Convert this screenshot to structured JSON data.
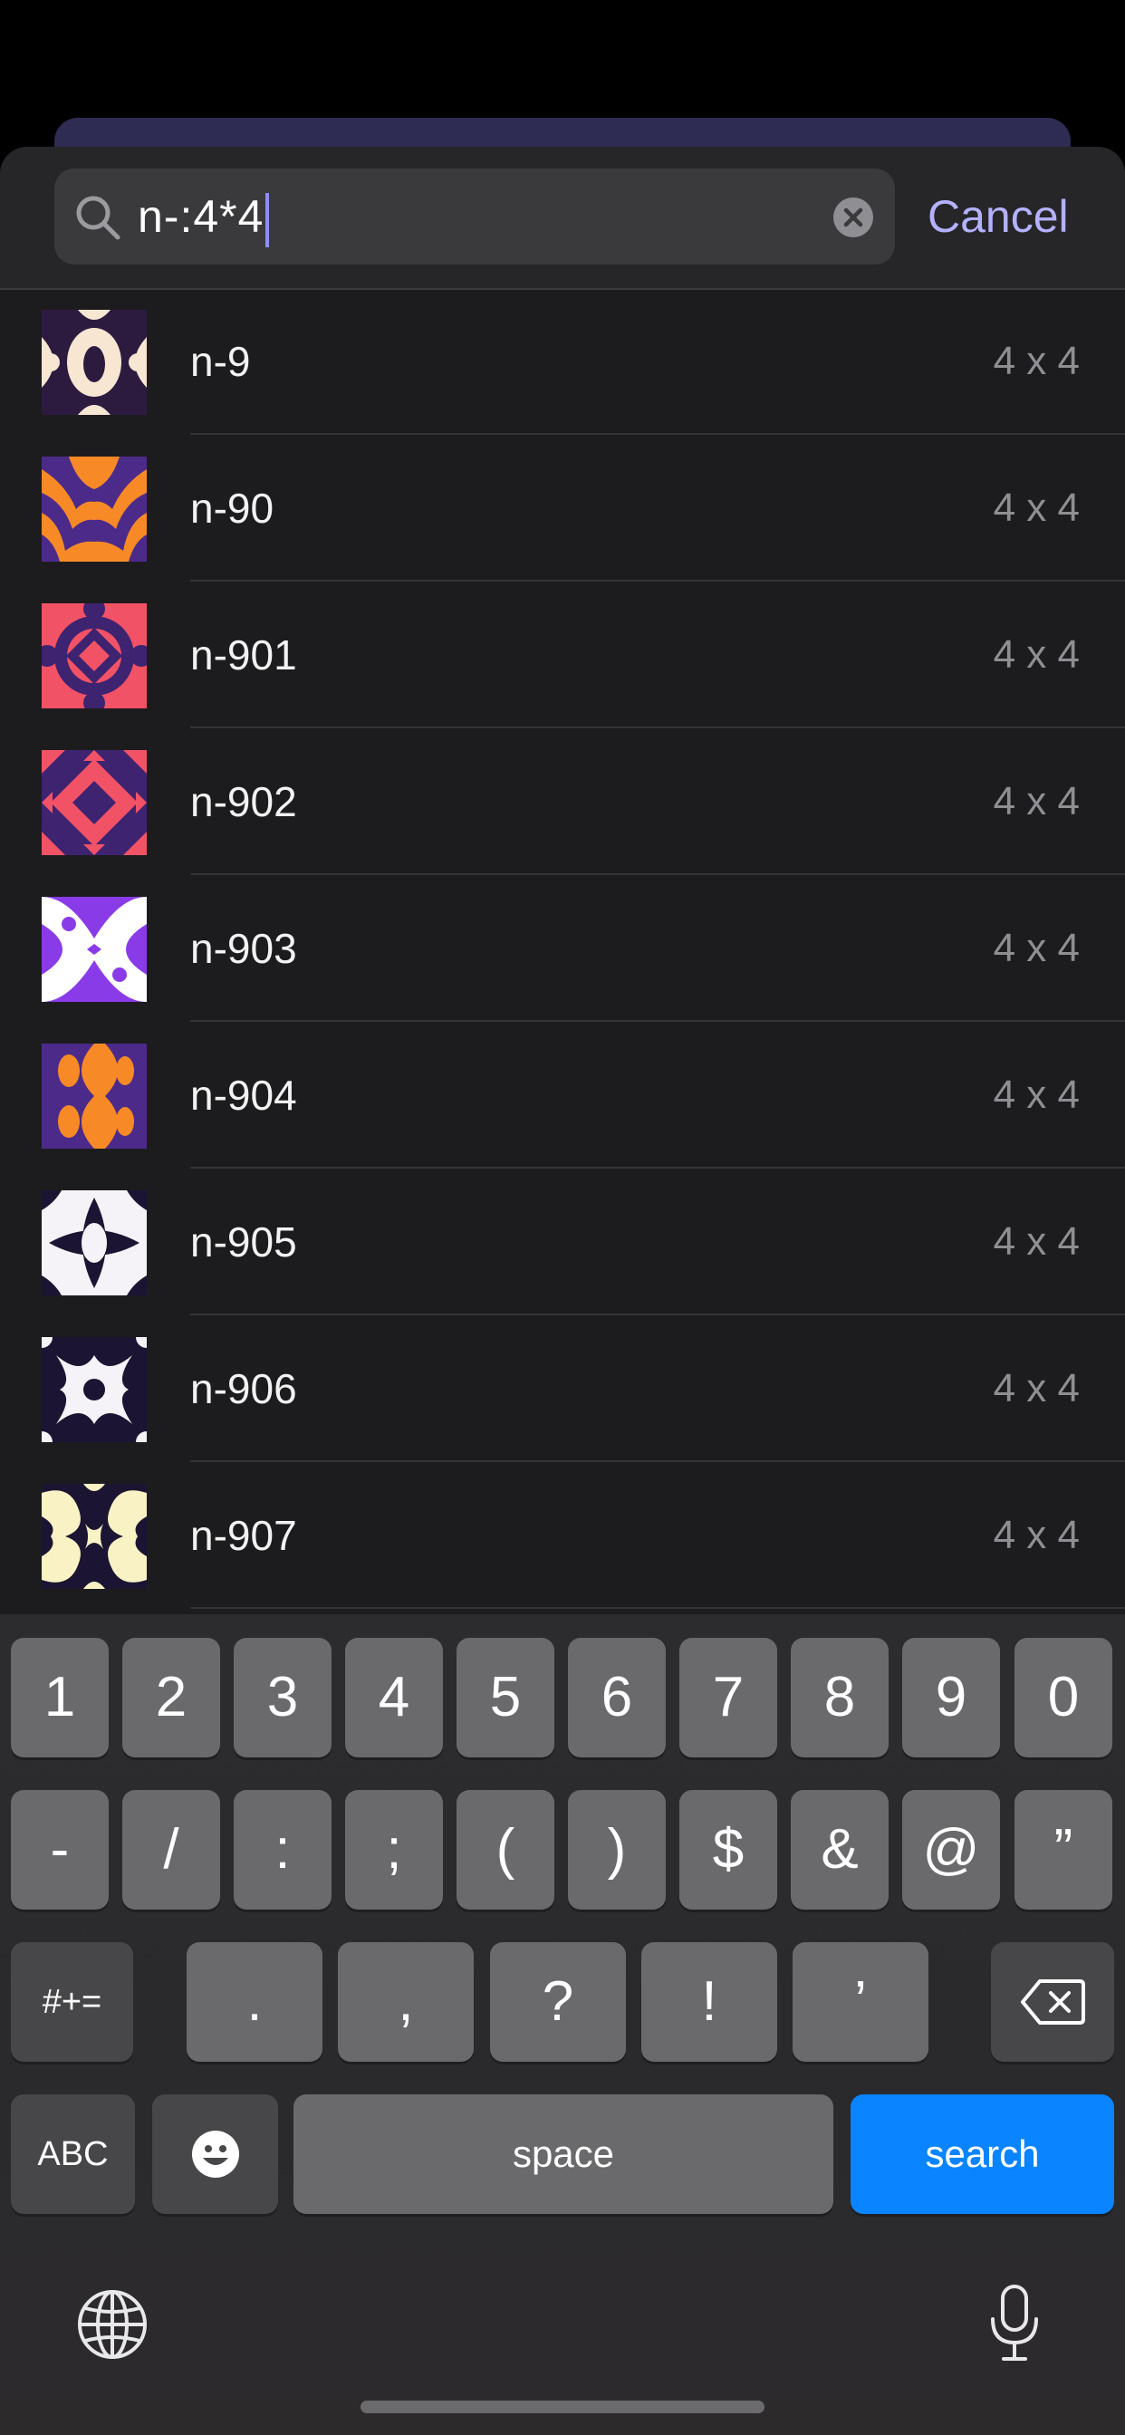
{
  "search": {
    "query": "n-:4*4",
    "cancel_label": "Cancel"
  },
  "results": [
    {
      "name": "n-9",
      "size": "4 x 4",
      "pattern": "cream-purple-blobs"
    },
    {
      "name": "n-90",
      "size": "4 x 4",
      "pattern": "orange-purple-waves"
    },
    {
      "name": "n-901",
      "size": "4 x 4",
      "pattern": "coral-purple-rings"
    },
    {
      "name": "n-902",
      "size": "4 x 4",
      "pattern": "coral-purple-diamonds"
    },
    {
      "name": "n-903",
      "size": "4 x 4",
      "pattern": "violet-white-x"
    },
    {
      "name": "n-904",
      "size": "4 x 4",
      "pattern": "orange-purple-mirror"
    },
    {
      "name": "n-905",
      "size": "4 x 4",
      "pattern": "white-navy-leaves"
    },
    {
      "name": "n-906",
      "size": "4 x 4",
      "pattern": "white-navy-stars"
    },
    {
      "name": "n-907",
      "size": "4 x 4",
      "pattern": "yellow-navy-waves"
    }
  ],
  "keyboard": {
    "row1": [
      "1",
      "2",
      "3",
      "4",
      "5",
      "6",
      "7",
      "8",
      "9",
      "0"
    ],
    "row2": [
      "-",
      "/",
      ":",
      ";",
      "(",
      ")",
      "$",
      "&",
      "@",
      "”"
    ],
    "row3": [
      ".",
      ",",
      "?",
      "!",
      "’"
    ],
    "symbols_label": "#+=",
    "abc_label": "ABC",
    "space_label": "space",
    "search_label": "search",
    "icons": [
      "backspace-icon",
      "emoji-icon",
      "globe-icon",
      "microphone-icon"
    ]
  },
  "colors": {
    "accent": "#b4b1ff",
    "search_key": "#0a84ff",
    "background": "#1c1c1e"
  }
}
